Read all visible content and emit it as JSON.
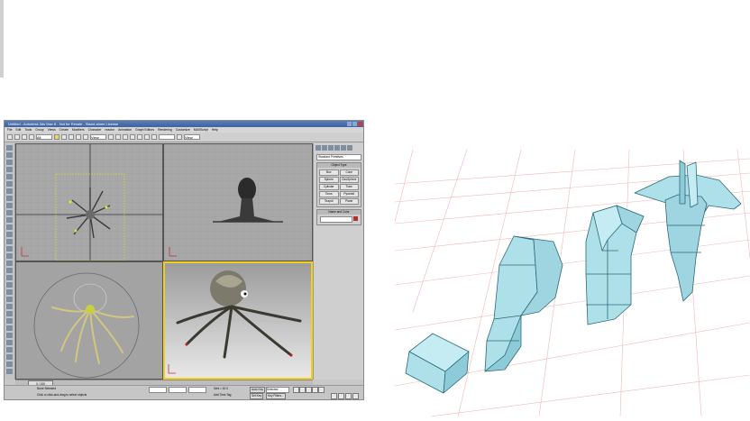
{
  "app": {
    "title": "Untitled - Autodesk 3ds Max 8 - Not for Resale - Stand-alone License",
    "menus": [
      "File",
      "Edit",
      "Tools",
      "Group",
      "Views",
      "Create",
      "Modifiers",
      "Character",
      "reactor",
      "Animation",
      "Graph Editors",
      "Rendering",
      "Customize",
      "MAXScript",
      "Help"
    ],
    "toolbar": {
      "filter_value": "All",
      "view_value": "View",
      "snap_value": "View"
    },
    "command_panel": {
      "category": "Standard Primitives",
      "rollout_title": "Object Type",
      "buttons": [
        "Box",
        "Cone",
        "Sphere",
        "GeoSphere",
        "Cylinder",
        "Tube",
        "Torus",
        "Pyramid",
        "Teapot",
        "Plane"
      ],
      "name_rollout": "Name and Color"
    },
    "timeline": {
      "frame": "0 / 100"
    },
    "status": {
      "selection": "None Selected",
      "prompt": "Click or click-and-drag to select objects",
      "add_time_tag": "Add Time Tag",
      "autokey": "Auto Key",
      "setkey": "Set Key",
      "selected": "Selected",
      "key_filters": "Key Filters...",
      "grid": "Grid = 10.0"
    },
    "colors": {
      "active_viewport": "#f3d018",
      "octopus": "#b9b48c",
      "head": "#2b2b2b"
    }
  },
  "ships": {
    "colors": {
      "fill": "#a9dbe6",
      "edge": "#2c6a78",
      "grid": "#f0b0b0"
    }
  }
}
